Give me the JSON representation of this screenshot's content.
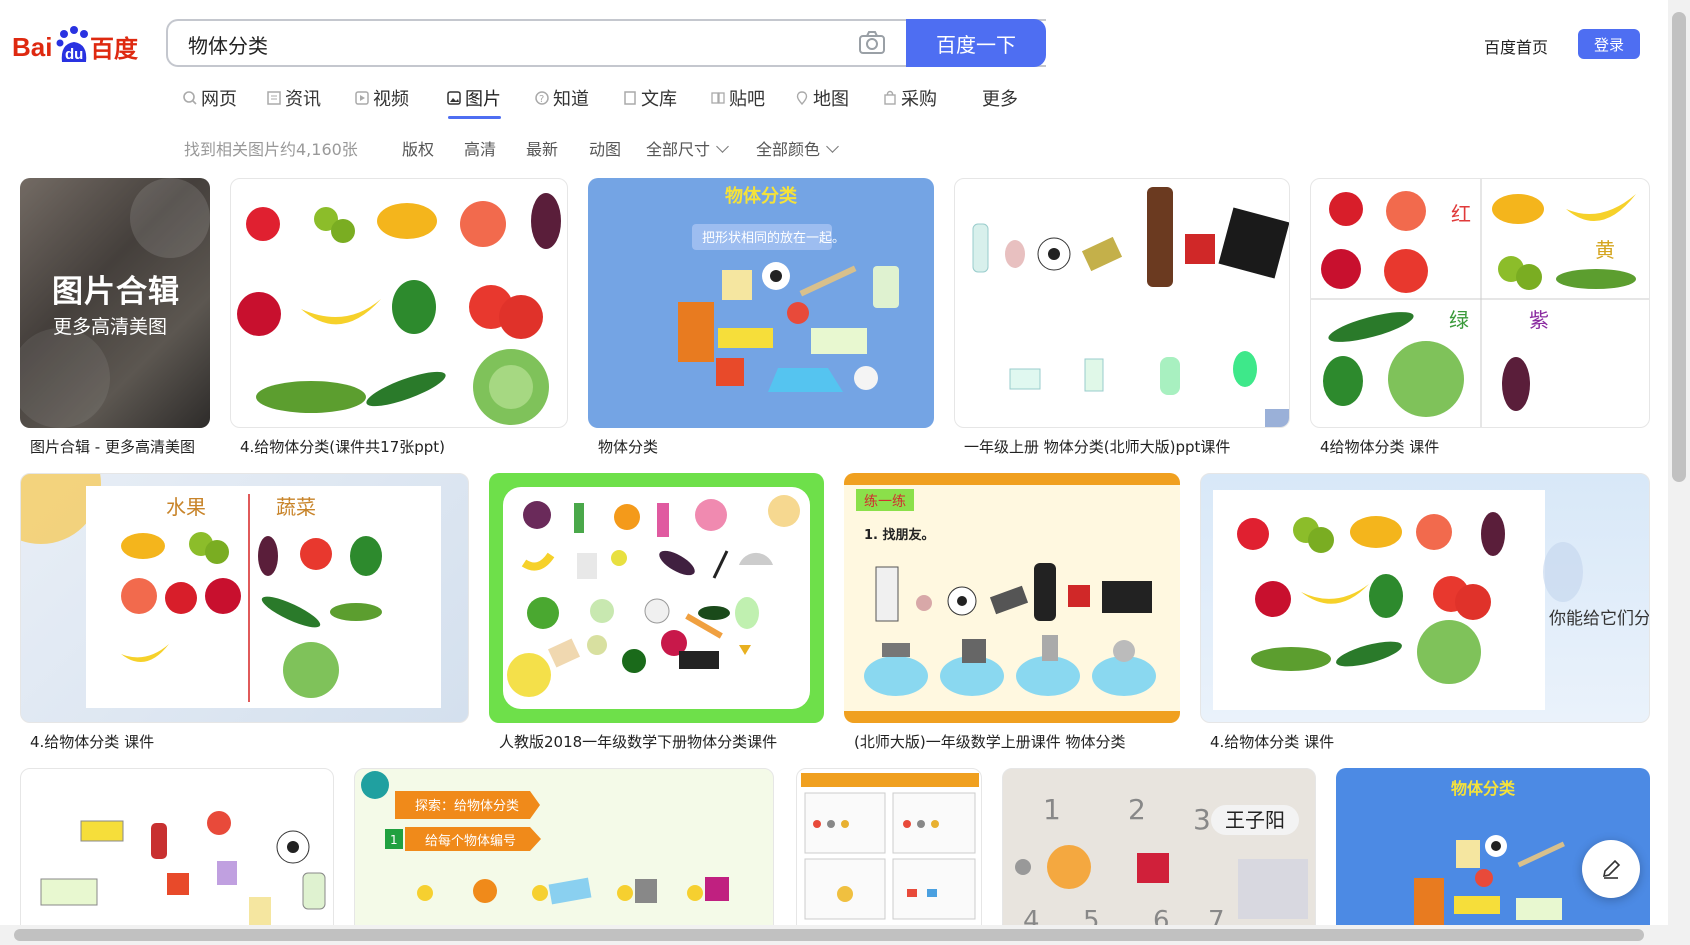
{
  "header": {
    "logo_text": "Bai du 百度",
    "search_value": "物体分类",
    "search_button": "百度一下",
    "home_link": "百度首页",
    "login_button": "登录"
  },
  "tabs": [
    {
      "label": "网页",
      "icon": "search-icon"
    },
    {
      "label": "资讯",
      "icon": "news-icon"
    },
    {
      "label": "视频",
      "icon": "video-icon"
    },
    {
      "label": "图片",
      "icon": "image-icon",
      "active": true
    },
    {
      "label": "知道",
      "icon": "question-icon"
    },
    {
      "label": "文库",
      "icon": "document-icon"
    },
    {
      "label": "贴吧",
      "icon": "tieba-icon"
    },
    {
      "label": "地图",
      "icon": "map-icon"
    },
    {
      "label": "采购",
      "icon": "shopping-icon"
    },
    {
      "label": "更多",
      "icon": ""
    }
  ],
  "filters": {
    "count": "找到相关图片约4,160张",
    "items": [
      "版权",
      "高清",
      "最新",
      "动图",
      "全部尺寸",
      "全部颜色"
    ]
  },
  "album": {
    "title": "图片合辑",
    "subtitle": "更多高清美图"
  },
  "captions": [
    "图片合辑 - 更多高清美图",
    "4.给物体分类(课件共17张ppt)",
    "物体分类",
    "一年级上册 物体分类(北师大版)ppt课件",
    "4给物体分类 课件",
    "4.给物体分类 课件",
    "人教版2018一年级数学下册物体分类课件",
    "(北师大版)一年级数学上册课件 物体分类",
    "4.给物体分类 课件"
  ],
  "image_text": {
    "c1_colors": [
      "红",
      "黄",
      "绿",
      "紫"
    ],
    "c2_title": "物体分类",
    "c2_sub": "把形状相同的放在一起。",
    "r2a_heads": [
      "水果",
      "蔬菜"
    ],
    "r2c_title": "练一练",
    "r2c_sub": "1. 找朋友。",
    "r2d_question": "你能给它们分类吗？",
    "r3b_head": "探索：给物体分类",
    "r3b_sub": "给每个物体编号",
    "r3d_name": "王子阳",
    "r3e_title": "物体分类"
  },
  "colors": {
    "accent": "#4e6ef2",
    "red_text": "#e03a3a",
    "green_text": "#3a9a3a",
    "purple_text": "#8a2aa0"
  }
}
